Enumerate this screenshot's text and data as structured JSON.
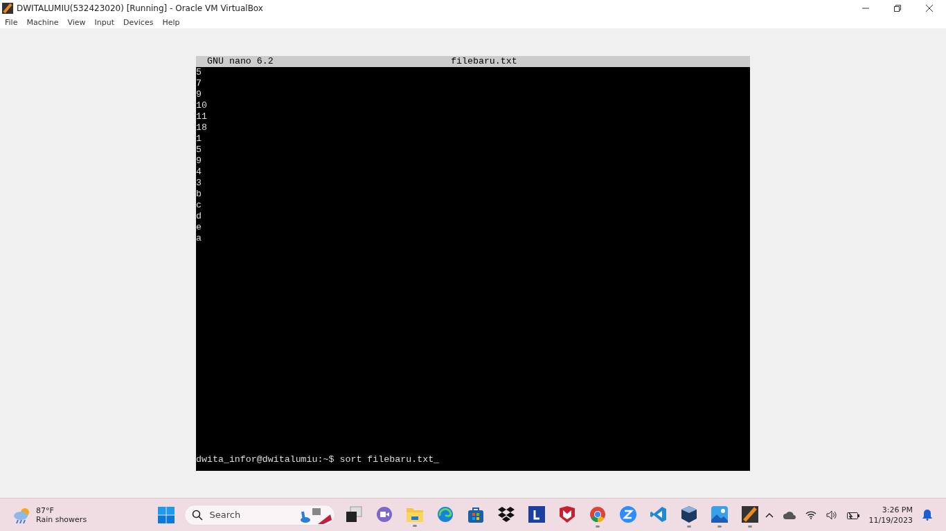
{
  "window": {
    "title": "DWITALUMIU(532423020) [Running] - Oracle VM VirtualBox"
  },
  "menu": [
    "File",
    "Machine",
    "View",
    "Input",
    "Devices",
    "Help"
  ],
  "nano": {
    "version": "GNU nano 6.2",
    "filename": "filebaru.txt",
    "lines": [
      "5",
      "7",
      "9",
      "10",
      "11",
      "18",
      "1",
      "5",
      "9",
      "4",
      "3",
      "b",
      "c",
      "d",
      "e",
      "a"
    ],
    "prompt": "dwita_infor@dwitalumiu:~$ sort filebaru.txt_"
  },
  "taskbar": {
    "weather": {
      "temp": "87°F",
      "condition": "Rain showers"
    },
    "search": {
      "placeholder": "Search"
    },
    "apps": [
      {
        "kind": "taskview",
        "running": false
      },
      {
        "kind": "chat",
        "running": false
      },
      {
        "kind": "folder",
        "running": true
      },
      {
        "kind": "edge",
        "running": false
      },
      {
        "kind": "store",
        "running": false
      },
      {
        "kind": "dropbox",
        "running": false
      },
      {
        "kind": "letter",
        "running": false
      },
      {
        "kind": "shield",
        "running": false
      },
      {
        "kind": "chrome",
        "running": true
      },
      {
        "kind": "zoom",
        "running": false
      },
      {
        "kind": "code",
        "running": false
      },
      {
        "kind": "cube",
        "running": true
      },
      {
        "kind": "photos",
        "running": true
      },
      {
        "kind": "vmwindow",
        "running": true
      }
    ],
    "time": "3:26 PM",
    "date": "11/19/2023"
  }
}
